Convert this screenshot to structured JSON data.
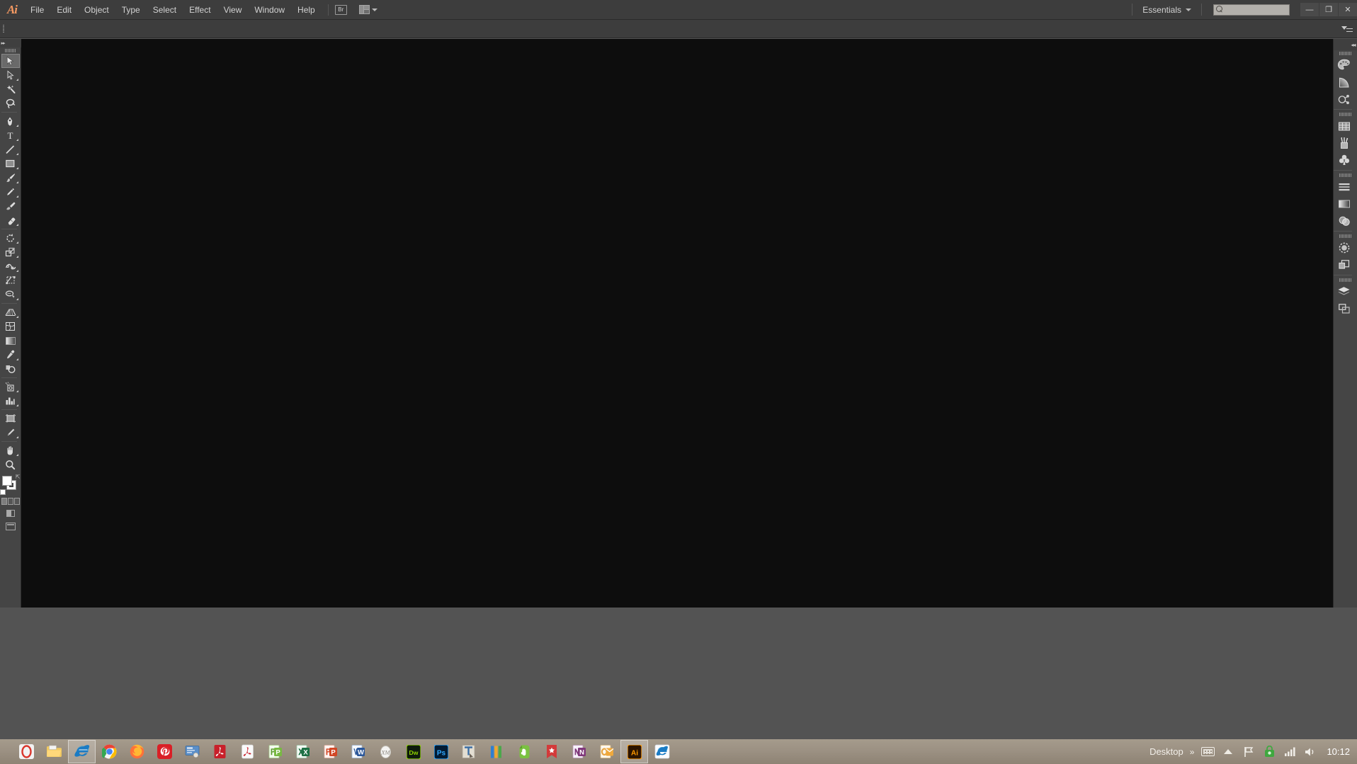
{
  "app": {
    "name": "Adobe Illustrator",
    "logo_text": "Ai"
  },
  "menubar": {
    "items": [
      {
        "label": "File"
      },
      {
        "label": "Edit"
      },
      {
        "label": "Object"
      },
      {
        "label": "Type"
      },
      {
        "label": "Select"
      },
      {
        "label": "Effect"
      },
      {
        "label": "View"
      },
      {
        "label": "Window"
      },
      {
        "label": "Help"
      }
    ],
    "bridge_label": "Br",
    "arrange_documents_tooltip": "Arrange Documents",
    "workspace": "Essentials",
    "search_placeholder": "",
    "search_value": "",
    "window_controls": {
      "minimize": "—",
      "restore": "❐",
      "close": "✕"
    }
  },
  "tools": {
    "panel_collapse": "▸▸",
    "items": [
      {
        "name": "selection-tool",
        "label": "Selection Tool (V)",
        "active": true,
        "has_flyout": false
      },
      {
        "name": "direct-selection-tool",
        "label": "Direct Selection Tool (A)",
        "active": false,
        "has_flyout": true
      },
      {
        "name": "magic-wand-tool",
        "label": "Magic Wand Tool (Y)",
        "active": false,
        "has_flyout": false
      },
      {
        "name": "lasso-tool",
        "label": "Lasso Tool (Q)",
        "active": false,
        "has_flyout": false
      },
      {
        "name": "pen-tool",
        "label": "Pen Tool (P)",
        "active": false,
        "has_flyout": true
      },
      {
        "name": "type-tool",
        "label": "Type Tool (T)",
        "active": false,
        "has_flyout": true
      },
      {
        "name": "line-segment-tool",
        "label": "Line Segment Tool (\\)",
        "active": false,
        "has_flyout": true
      },
      {
        "name": "rectangle-tool",
        "label": "Rectangle Tool (M)",
        "active": false,
        "has_flyout": true
      },
      {
        "name": "paintbrush-tool",
        "label": "Paintbrush Tool (B)",
        "active": false,
        "has_flyout": true
      },
      {
        "name": "pencil-tool",
        "label": "Pencil Tool (N)",
        "active": false,
        "has_flyout": true
      },
      {
        "name": "blob-brush-tool",
        "label": "Blob Brush Tool (Shift+B)",
        "active": false,
        "has_flyout": false
      },
      {
        "name": "eraser-tool",
        "label": "Eraser Tool (Shift+E)",
        "active": false,
        "has_flyout": true
      },
      {
        "name": "rotate-tool",
        "label": "Rotate Tool (R)",
        "active": false,
        "has_flyout": true
      },
      {
        "name": "scale-tool",
        "label": "Scale Tool (S)",
        "active": false,
        "has_flyout": true
      },
      {
        "name": "width-tool",
        "label": "Width Tool (Shift+W)",
        "active": false,
        "has_flyout": true
      },
      {
        "name": "free-transform-tool",
        "label": "Free Transform Tool (E)",
        "active": false,
        "has_flyout": false
      },
      {
        "name": "shape-builder-tool",
        "label": "Shape Builder Tool (Shift+M)",
        "active": false,
        "has_flyout": true
      },
      {
        "name": "perspective-grid-tool",
        "label": "Perspective Grid Tool (Shift+P)",
        "active": false,
        "has_flyout": true
      },
      {
        "name": "mesh-tool",
        "label": "Mesh Tool (U)",
        "active": false,
        "has_flyout": false
      },
      {
        "name": "gradient-tool",
        "label": "Gradient Tool (G)",
        "active": false,
        "has_flyout": false
      },
      {
        "name": "eyedropper-tool",
        "label": "Eyedropper Tool (I)",
        "active": false,
        "has_flyout": true
      },
      {
        "name": "blend-tool",
        "label": "Blend Tool (W)",
        "active": false,
        "has_flyout": false
      },
      {
        "name": "symbol-sprayer-tool",
        "label": "Symbol Sprayer Tool (Shift+S)",
        "active": false,
        "has_flyout": true
      },
      {
        "name": "column-graph-tool",
        "label": "Column Graph Tool (J)",
        "active": false,
        "has_flyout": true
      },
      {
        "name": "artboard-tool",
        "label": "Artboard Tool (Shift+O)",
        "active": false,
        "has_flyout": false
      },
      {
        "name": "slice-tool",
        "label": "Slice Tool (Shift+K)",
        "active": false,
        "has_flyout": true
      },
      {
        "name": "hand-tool",
        "label": "Hand Tool (H)",
        "active": false,
        "has_flyout": true
      },
      {
        "name": "zoom-tool",
        "label": "Zoom Tool (Z)",
        "active": false,
        "has_flyout": false
      }
    ],
    "fill_stroke": {
      "fill_label": "Fill",
      "stroke_label": "Stroke",
      "fill_color": "#ffffff",
      "stroke_color": "#ffffff",
      "swap_label": "Swap Fill and Stroke",
      "default_label": "Default Fill and Stroke"
    },
    "paint_modes": [
      "Color",
      "Gradient",
      "None"
    ],
    "drawing_modes_label": "Drawing Modes",
    "screen_mode_label": "Change Screen Mode"
  },
  "dock": {
    "collapse_label": "◂◂",
    "panel_menu_label": "Panel Menu",
    "groups": [
      {
        "items": [
          {
            "name": "color-panel",
            "label": "Color"
          },
          {
            "name": "color-guide-panel",
            "label": "Color Guide"
          },
          {
            "name": "stroke-panel",
            "label": "Stroke"
          }
        ]
      },
      {
        "items": [
          {
            "name": "swatches-panel",
            "label": "Swatches"
          },
          {
            "name": "brushes-panel",
            "label": "Brushes"
          },
          {
            "name": "symbols-panel",
            "label": "Symbols"
          }
        ]
      },
      {
        "items": [
          {
            "name": "align-panel",
            "label": "Align"
          },
          {
            "name": "gradient-panel",
            "label": "Gradient"
          },
          {
            "name": "transparency-panel",
            "label": "Transparency"
          }
        ]
      },
      {
        "items": [
          {
            "name": "appearance-panel",
            "label": "Appearance"
          },
          {
            "name": "graphic-styles-panel",
            "label": "Graphic Styles"
          }
        ]
      },
      {
        "items": [
          {
            "name": "layers-panel",
            "label": "Layers"
          },
          {
            "name": "artboards-panel",
            "label": "Artboards"
          }
        ]
      }
    ]
  },
  "canvas": {
    "background_color": "#0d0d0d",
    "document_open": false
  },
  "taskbar": {
    "items": [
      {
        "name": "opera-taskbar-icon",
        "label": "Opera",
        "glyph": "O",
        "bg": "#f0f0f0",
        "fg": "#d9362c",
        "active": false
      },
      {
        "name": "file-explorer-taskbar-icon",
        "label": "File Explorer",
        "glyph": "",
        "bg": "#f2d58a",
        "fg": "#8a6b1f",
        "active": false
      },
      {
        "name": "internet-explorer-taskbar-icon",
        "label": "Internet Explorer",
        "glyph": "e",
        "bg": "#eef6fb",
        "fg": "#1a7bc4",
        "active": true
      },
      {
        "name": "google-chrome-taskbar-icon",
        "label": "Google Chrome",
        "glyph": "",
        "bg": "#ffffff",
        "fg": "#4285f4",
        "active": false
      },
      {
        "name": "firefox-taskbar-icon",
        "label": "Mozilla Firefox",
        "glyph": "",
        "bg": "#ff9500",
        "fg": "#1565c0",
        "active": false
      },
      {
        "name": "creative-cloud-taskbar-icon",
        "label": "Adobe Creative Cloud",
        "glyph": "",
        "bg": "#d11b1b",
        "fg": "#ffffff",
        "active": false
      },
      {
        "name": "remote-desktop-taskbar-icon",
        "label": "Remote Desktop",
        "glyph": "",
        "bg": "#5b8fc9",
        "fg": "#ffffff",
        "active": false
      },
      {
        "name": "adobe-reader-taskbar-icon",
        "label": "Adobe Reader",
        "glyph": "Λ",
        "bg": "#c8202a",
        "fg": "#ffffff",
        "active": false
      },
      {
        "name": "adobe-acrobat-taskbar-icon",
        "label": "Adobe Acrobat",
        "glyph": "Λ",
        "bg": "#f5f5f5",
        "fg": "#c8202a",
        "active": false
      },
      {
        "name": "powerpoint-viewer-taskbar-icon",
        "label": "PowerPoint Viewer",
        "glyph": "P",
        "bg": "#78b942",
        "fg": "#ffffff",
        "active": false
      },
      {
        "name": "excel-taskbar-icon",
        "label": "Microsoft Excel",
        "glyph": "X",
        "bg": "#f3f7f2",
        "fg": "#1d7044",
        "active": false
      },
      {
        "name": "powerpoint-taskbar-icon",
        "label": "Microsoft PowerPoint",
        "glyph": "P",
        "bg": "#f7f3f0",
        "fg": "#d24726",
        "active": false
      },
      {
        "name": "word-taskbar-icon",
        "label": "Microsoft Word",
        "glyph": "W",
        "bg": "#f2f6fb",
        "fg": "#2b579a",
        "active": false
      },
      {
        "name": "xmind-taskbar-icon",
        "label": "XMind",
        "glyph": "",
        "bg": "#e8e8e8",
        "fg": "#777777",
        "active": false
      },
      {
        "name": "dreamweaver-taskbar-icon",
        "label": "Adobe Dreamweaver",
        "glyph": "Dw",
        "bg": "#1d1d1d",
        "fg": "#8fd400",
        "active": false
      },
      {
        "name": "photoshop-taskbar-icon",
        "label": "Adobe Photoshop",
        "glyph": "Ps",
        "bg": "#021b33",
        "fg": "#31a8ff",
        "active": false
      },
      {
        "name": "typography-app-taskbar-icon",
        "label": "Typography Tool",
        "glyph": "T",
        "bg": "#dedace",
        "fg": "#2b6fa8",
        "active": false
      },
      {
        "name": "bars-app-taskbar-icon",
        "label": "Media Player",
        "glyph": "",
        "bg": "#ffffff",
        "fg": "#2f7fd1",
        "active": false
      },
      {
        "name": "evernote-taskbar-icon",
        "label": "Evernote",
        "glyph": "",
        "bg": "#7bc142",
        "fg": "#ffffff",
        "active": false
      },
      {
        "name": "bookmark-app-taskbar-icon",
        "label": "Bookmark Manager",
        "glyph": "★",
        "bg": "#d33a3a",
        "fg": "#ffffff",
        "active": false
      },
      {
        "name": "onenote-taskbar-icon",
        "label": "Microsoft OneNote",
        "glyph": "N",
        "bg": "#f4eff7",
        "fg": "#80397b",
        "active": false
      },
      {
        "name": "outlook-taskbar-icon",
        "label": "Microsoft Outlook",
        "glyph": "O",
        "bg": "#fdf6ea",
        "fg": "#e8a33d",
        "active": false
      },
      {
        "name": "illustrator-taskbar-icon",
        "label": "Adobe Illustrator",
        "glyph": "Ai",
        "bg": "#2b1400",
        "fg": "#ff9a00",
        "active": true
      },
      {
        "name": "internet-explorer-2-taskbar-icon",
        "label": "Internet Explorer",
        "glyph": "e",
        "bg": "#eef6fb",
        "fg": "#1a7bc4",
        "active": false
      }
    ],
    "tray": {
      "desktop_label": "Desktop",
      "overflow_glyph": "»",
      "keyboard_label": "Touch Keyboard",
      "show_hidden_label": "Show hidden icons",
      "flag_label": "Action Center",
      "security_label": "Security",
      "network_label": "Network",
      "volume_label": "Volume",
      "time": "10:12"
    }
  }
}
